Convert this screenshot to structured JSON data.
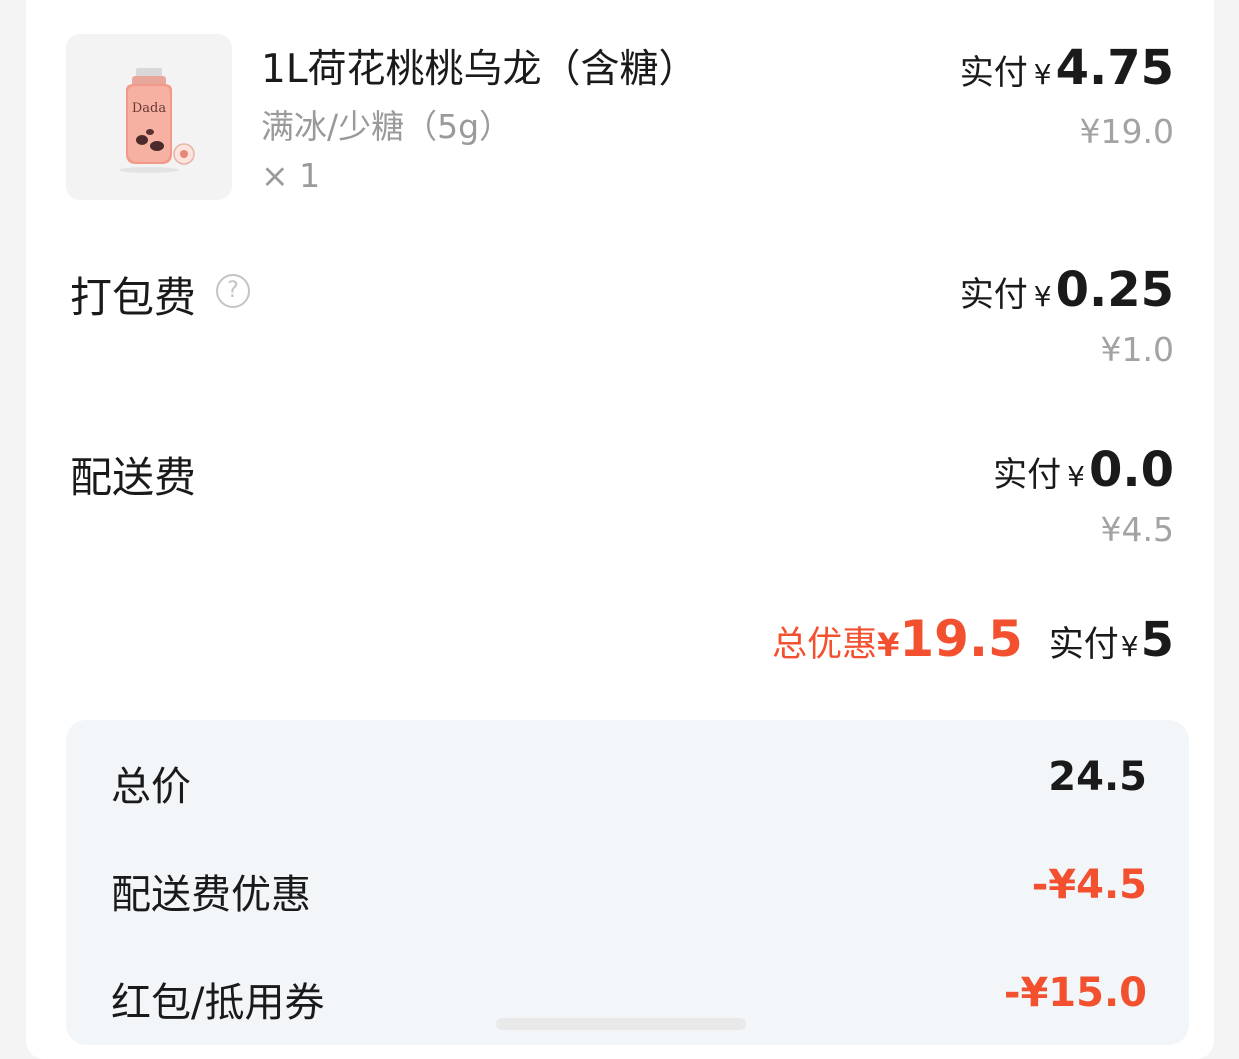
{
  "product": {
    "name": "1L荷花桃桃乌龙（含糖）",
    "spec": "满冰/少糖（5g）",
    "qty": "× 1",
    "image_text": "Dada",
    "paid_label": "实付",
    "currency": "¥",
    "paid_amount": "4.75",
    "original_price": "¥19.0"
  },
  "packing_fee": {
    "label": "打包费",
    "help_icon": "question-circle-icon",
    "paid_label": "实付",
    "currency": "¥",
    "paid_amount": "0.25",
    "original_price": "¥1.0"
  },
  "delivery_fee": {
    "label": "配送费",
    "paid_label": "实付",
    "currency": "¥",
    "paid_amount": "0.0",
    "original_price": "¥4.5"
  },
  "summary": {
    "discount_label": "总优惠",
    "discount_currency": "¥",
    "discount_amount": "19.5",
    "paid_label": "实付",
    "paid_currency": "¥",
    "paid_amount": "5"
  },
  "breakdown": [
    {
      "label": "总价",
      "value": "24.5"
    },
    {
      "label": "配送费优惠",
      "value": "-¥4.5"
    },
    {
      "label": "红包/抵用券",
      "value": "-¥15.0"
    }
  ],
  "colors": {
    "accent_red": "#f2502e",
    "text_dark": "#1a1a1a",
    "text_gray": "#9a9a9a",
    "panel_bg": "#f3f6f9"
  }
}
